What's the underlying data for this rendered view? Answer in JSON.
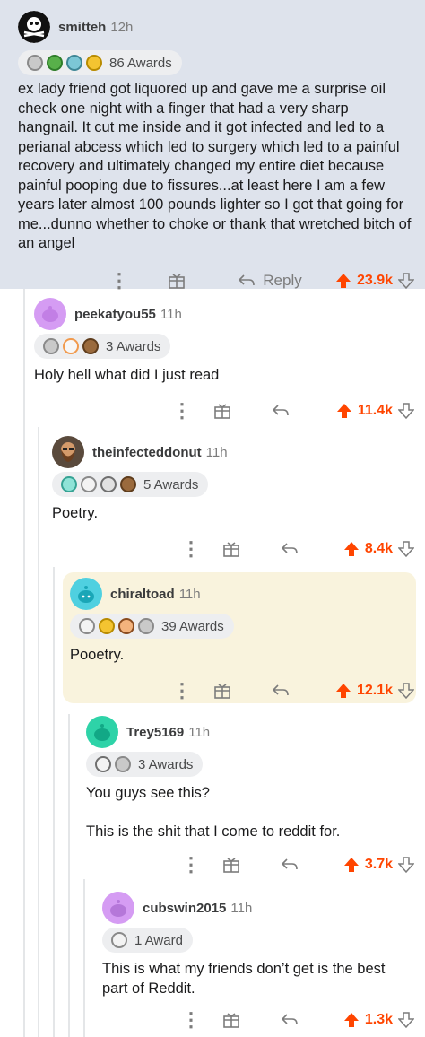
{
  "comments": [
    {
      "username": "smitteh",
      "time": "12h",
      "awards": "86 Awards",
      "paragraphs": [
        "ex lady friend got liquored up and gave me a surprise oil check one night with a finger that had a very sharp hangnail.  It cut me inside and it got infected and led to a perianal abcess which led to surgery which led to a painful recovery and ultimately changed my entire diet because painful pooping due to fissures...at least here I am a few years later almost 100 pounds lighter so I got that going for me...dunno whether to choke or thank that wretched bitch of an angel"
      ],
      "reply_label": "Reply",
      "score": "23.9k",
      "award_icons": [
        "pirate-award-icon",
        "clover-award-icon",
        "coin-award-icon",
        "crown-award-icon"
      ]
    },
    {
      "username": "peekatyou55",
      "time": "11h",
      "awards": "3 Awards",
      "paragraphs": [
        "Holy hell what did I just read"
      ],
      "score": "11.4k",
      "award_icons": [
        "hands-award-icon",
        "wholesome-award-icon",
        "bear-award-icon"
      ]
    },
    {
      "username": "theinfecteddonut",
      "time": "11h",
      "awards": "5 Awards",
      "paragraphs": [
        "Poetry."
      ],
      "score": "8.4k",
      "award_icons": [
        "laugh-award-icon",
        "face-award-icon",
        "silver-award-icon",
        "bear-award-icon"
      ]
    },
    {
      "username": "chiraltoad",
      "time": "11h",
      "awards": "39 Awards",
      "paragraphs": [
        "Pooetry."
      ],
      "score": "12.1k",
      "award_icons": [
        "snoo-award-icon",
        "crown-award-icon",
        "face-award-icon",
        "hands-award-icon"
      ]
    },
    {
      "username": "Trey5169",
      "time": "11h",
      "awards": "3 Awards",
      "paragraphs": [
        "You guys see this?",
        "This is the shit that I come to reddit for."
      ],
      "score": "3.7k",
      "award_icons": [
        "heart-hands-award-icon",
        "hands-award-icon"
      ]
    },
    {
      "username": "cubswin2015",
      "time": "11h",
      "awards": "1 Award",
      "paragraphs": [
        "This is what my friends don’t get is the best part of Reddit."
      ],
      "score": "1.3k",
      "award_icons": [
        "face-award-icon"
      ]
    }
  ],
  "colors": {
    "upvote": "#ff4500",
    "highlight_bg": "#f9f3dd",
    "top_bg": "#dee3ec"
  }
}
